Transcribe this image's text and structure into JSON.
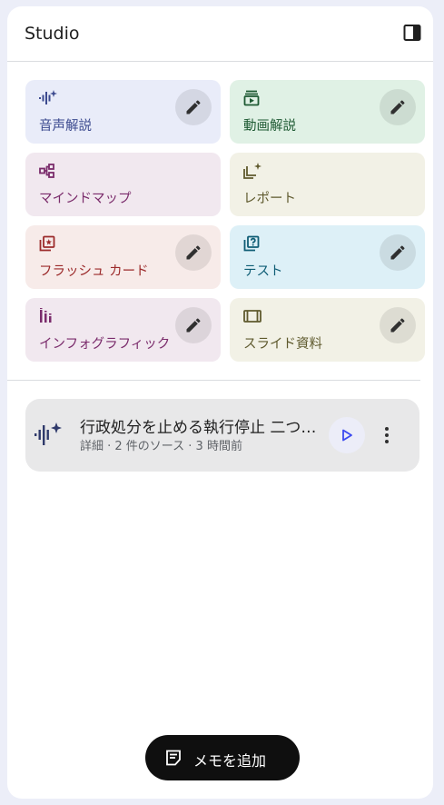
{
  "header": {
    "title": "Studio"
  },
  "tiles": [
    {
      "label": "音声解説",
      "icon": "audio-sparkle-icon",
      "has_edit": true,
      "bg": "#e9ecf9",
      "fg": "#3c4a8f"
    },
    {
      "label": "動画解説",
      "icon": "video-icon",
      "has_edit": true,
      "bg": "#e0f1e5",
      "fg": "#1e5a33"
    },
    {
      "label": "マインドマップ",
      "icon": "mind-map-icon",
      "has_edit": false,
      "bg": "#f1e8ef",
      "fg": "#7a2b6b"
    },
    {
      "label": "レポート",
      "icon": "report-icon",
      "has_edit": false,
      "bg": "#f2f1e6",
      "fg": "#5f5a2e"
    },
    {
      "label": "フラッシュ カード",
      "icon": "flashcard-icon",
      "has_edit": true,
      "bg": "#f7ebe9",
      "fg": "#9c2b2b"
    },
    {
      "label": "テスト",
      "icon": "quiz-icon",
      "has_edit": true,
      "bg": "#ddf0f7",
      "fg": "#0f5d75"
    },
    {
      "label": "インフォグラフィック",
      "icon": "infographic-icon",
      "has_edit": true,
      "bg": "#f1e8ef",
      "fg": "#7a2b6b"
    },
    {
      "label": "スライド資料",
      "icon": "slides-icon",
      "has_edit": true,
      "bg": "#f2f1e6",
      "fg": "#5f5a2e"
    }
  ],
  "note": {
    "title": "行政処分を止める執行停止 二つの要件",
    "subtitle": "詳細 · 2 件のソース · 3 時間前"
  },
  "add_memo": {
    "label": "メモを追加"
  },
  "colors": {
    "accent": "#3c4af0",
    "panel_bg": "#ffffff",
    "page_bg": "#eceef8"
  }
}
